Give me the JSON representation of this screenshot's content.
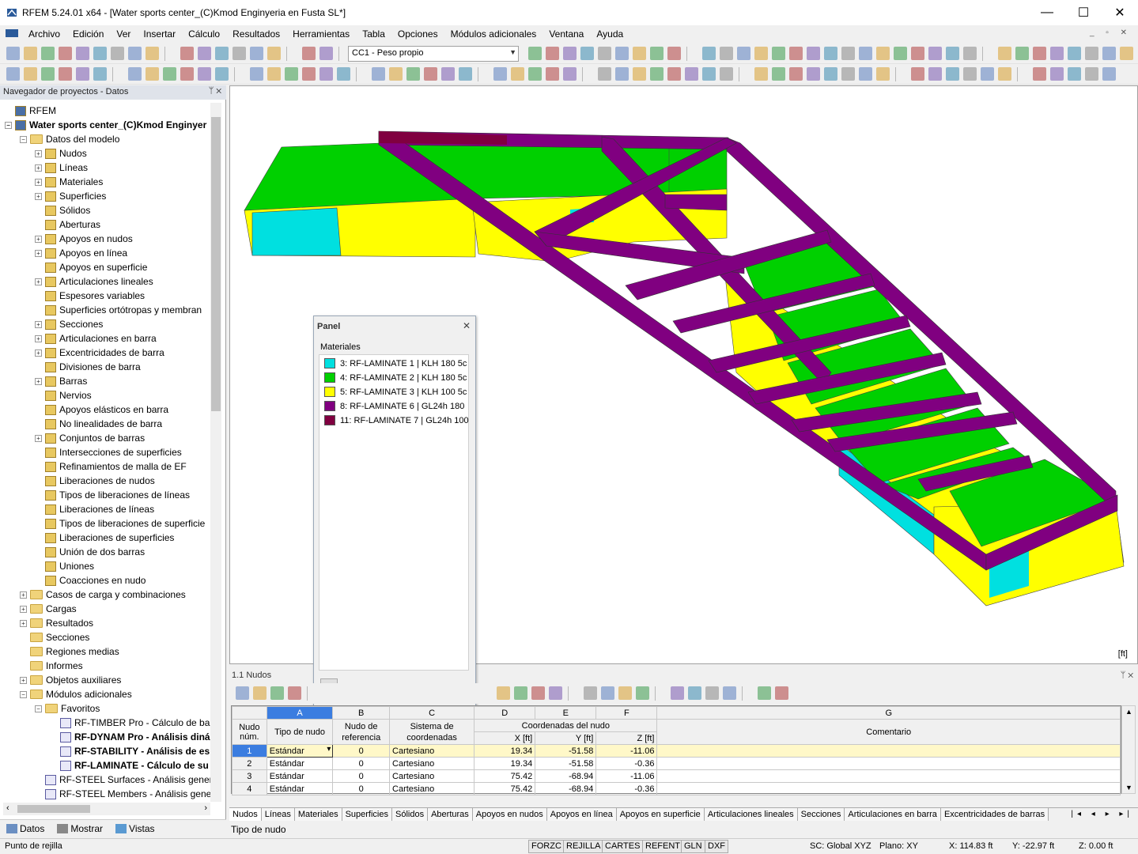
{
  "window": {
    "title": "RFEM 5.24.01 x64 - [Water sports center_(C)Kmod Enginyeria en Fusta SL*]",
    "minimize": "—",
    "maximize": "☐",
    "close": "✕"
  },
  "menu": [
    "Archivo",
    "Edición",
    "Ver",
    "Insertar",
    "Cálculo",
    "Resultados",
    "Herramientas",
    "Tabla",
    "Opciones",
    "Módulos adicionales",
    "Ventana",
    "Ayuda"
  ],
  "toolbar": {
    "load_case": "CC1 - Peso propio"
  },
  "navigator": {
    "title": "Navegador de proyectos - Datos",
    "items": [
      {
        "label": "RFEM",
        "lvl": 0,
        "ex": "",
        "icon": "rfem"
      },
      {
        "label": "Water sports center_(C)Kmod Enginyer",
        "lvl": 0,
        "ex": "−",
        "icon": "model",
        "bold": true
      },
      {
        "label": "Datos del modelo",
        "lvl": 1,
        "ex": "−",
        "icon": "folder"
      },
      {
        "label": "Nudos",
        "lvl": 2,
        "ex": "+",
        "icon": "doc"
      },
      {
        "label": "Líneas",
        "lvl": 2,
        "ex": "+",
        "icon": "doc"
      },
      {
        "label": "Materiales",
        "lvl": 2,
        "ex": "+",
        "icon": "doc"
      },
      {
        "label": "Superficies",
        "lvl": 2,
        "ex": "+",
        "icon": "doc"
      },
      {
        "label": "Sólidos",
        "lvl": 2,
        "ex": "",
        "icon": "doc"
      },
      {
        "label": "Aberturas",
        "lvl": 2,
        "ex": "",
        "icon": "doc"
      },
      {
        "label": "Apoyos en nudos",
        "lvl": 2,
        "ex": "+",
        "icon": "doc"
      },
      {
        "label": "Apoyos en línea",
        "lvl": 2,
        "ex": "+",
        "icon": "doc"
      },
      {
        "label": "Apoyos en superficie",
        "lvl": 2,
        "ex": "",
        "icon": "doc"
      },
      {
        "label": "Articulaciones lineales",
        "lvl": 2,
        "ex": "+",
        "icon": "doc"
      },
      {
        "label": "Espesores variables",
        "lvl": 2,
        "ex": "",
        "icon": "doc"
      },
      {
        "label": "Superficies ortótropas y membran",
        "lvl": 2,
        "ex": "",
        "icon": "doc"
      },
      {
        "label": "Secciones",
        "lvl": 2,
        "ex": "+",
        "icon": "doc"
      },
      {
        "label": "Articulaciones en barra",
        "lvl": 2,
        "ex": "+",
        "icon": "doc"
      },
      {
        "label": "Excentricidades de barra",
        "lvl": 2,
        "ex": "+",
        "icon": "doc"
      },
      {
        "label": "Divisiones de barra",
        "lvl": 2,
        "ex": "",
        "icon": "doc"
      },
      {
        "label": "Barras",
        "lvl": 2,
        "ex": "+",
        "icon": "doc"
      },
      {
        "label": "Nervios",
        "lvl": 2,
        "ex": "",
        "icon": "doc"
      },
      {
        "label": "Apoyos elásticos en barra",
        "lvl": 2,
        "ex": "",
        "icon": "doc"
      },
      {
        "label": "No linealidades de barra",
        "lvl": 2,
        "ex": "",
        "icon": "doc"
      },
      {
        "label": "Conjuntos de barras",
        "lvl": 2,
        "ex": "+",
        "icon": "doc"
      },
      {
        "label": "Intersecciones de superficies",
        "lvl": 2,
        "ex": "",
        "icon": "doc"
      },
      {
        "label": "Refinamientos de malla de EF",
        "lvl": 2,
        "ex": "",
        "icon": "doc"
      },
      {
        "label": "Liberaciones de nudos",
        "lvl": 2,
        "ex": "",
        "icon": "doc"
      },
      {
        "label": "Tipos de liberaciones de líneas",
        "lvl": 2,
        "ex": "",
        "icon": "doc"
      },
      {
        "label": "Liberaciones de líneas",
        "lvl": 2,
        "ex": "",
        "icon": "doc"
      },
      {
        "label": "Tipos de liberaciones de superficie",
        "lvl": 2,
        "ex": "",
        "icon": "doc"
      },
      {
        "label": "Liberaciones de superficies",
        "lvl": 2,
        "ex": "",
        "icon": "doc"
      },
      {
        "label": "Unión de dos barras",
        "lvl": 2,
        "ex": "",
        "icon": "doc"
      },
      {
        "label": "Uniones",
        "lvl": 2,
        "ex": "",
        "icon": "doc"
      },
      {
        "label": "Coacciones en nudo",
        "lvl": 2,
        "ex": "",
        "icon": "doc"
      },
      {
        "label": "Casos de carga y combinaciones",
        "lvl": 1,
        "ex": "+",
        "icon": "folder"
      },
      {
        "label": "Cargas",
        "lvl": 1,
        "ex": "+",
        "icon": "folder"
      },
      {
        "label": "Resultados",
        "lvl": 1,
        "ex": "+",
        "icon": "folder"
      },
      {
        "label": "Secciones",
        "lvl": 1,
        "ex": "",
        "icon": "folder"
      },
      {
        "label": "Regiones medias",
        "lvl": 1,
        "ex": "",
        "icon": "folder"
      },
      {
        "label": "Informes",
        "lvl": 1,
        "ex": "",
        "icon": "folder"
      },
      {
        "label": "Objetos auxiliares",
        "lvl": 1,
        "ex": "+",
        "icon": "folder"
      },
      {
        "label": "Módulos adicionales",
        "lvl": 1,
        "ex": "−",
        "icon": "folder"
      },
      {
        "label": "Favoritos",
        "lvl": 2,
        "ex": "−",
        "icon": "folder"
      },
      {
        "label": "RF-TIMBER Pro - Cálculo de ba",
        "lvl": 3,
        "ex": "",
        "icon": "mod"
      },
      {
        "label": "RF-DYNAM Pro - Análisis diná",
        "lvl": 3,
        "ex": "",
        "icon": "mod",
        "bold": true
      },
      {
        "label": "RF-STABILITY - Análisis de es",
        "lvl": 3,
        "ex": "",
        "icon": "mod",
        "bold": true
      },
      {
        "label": "RF-LAMINATE - Cálculo de su",
        "lvl": 3,
        "ex": "",
        "icon": "mod",
        "bold": true
      },
      {
        "label": "RF-STEEL Surfaces - Análisis gener",
        "lvl": 2,
        "ex": "",
        "icon": "mod"
      },
      {
        "label": "RF-STEEL Members - Análisis gene",
        "lvl": 2,
        "ex": "",
        "icon": "mod"
      }
    ],
    "tabs": [
      "Datos",
      "Mostrar",
      "Vistas"
    ]
  },
  "viewport": {
    "unit": "[ft]"
  },
  "panel": {
    "title": "Panel",
    "group": "Materiales",
    "legend": [
      {
        "label": "3: RF-LAMINATE 1 | KLH 180 5c",
        "color": "#00e0e0"
      },
      {
        "label": "4: RF-LAMINATE 2 | KLH 180 5c",
        "color": "#00d000"
      },
      {
        "label": "5: RF-LAMINATE 3 | KLH 100 5c",
        "color": "#ffff00"
      },
      {
        "label": "8: RF-LAMINATE 6 | GL24h 180",
        "color": "#800080"
      },
      {
        "label": "11: RF-LAMINATE 7 | GL24h 100",
        "color": "#800040"
      }
    ]
  },
  "table": {
    "title": "1.1 Nudos",
    "col_letters": [
      "A",
      "B",
      "C",
      "D",
      "E",
      "F",
      "G"
    ],
    "h_nudo": "Nudo",
    "h_num": "núm.",
    "h_tipo": "Tipo de nudo",
    "h_ref1": "Nudo de",
    "h_ref2": "referencia",
    "h_sis1": "Sistema de",
    "h_sis2": "coordenadas",
    "h_coord": "Coordenadas del nudo",
    "h_x": "X [ft]",
    "h_y": "Y [ft]",
    "h_z": "Z [ft]",
    "h_com": "Comentario",
    "rows": [
      {
        "n": "1",
        "tipo": "Estándar",
        "ref": "0",
        "sis": "Cartesiano",
        "x": "19.34",
        "y": "-51.58",
        "z": "-11.06"
      },
      {
        "n": "2",
        "tipo": "Estándar",
        "ref": "0",
        "sis": "Cartesiano",
        "x": "19.34",
        "y": "-51.58",
        "z": "-0.36"
      },
      {
        "n": "3",
        "tipo": "Estándar",
        "ref": "0",
        "sis": "Cartesiano",
        "x": "75.42",
        "y": "-68.94",
        "z": "-11.06"
      },
      {
        "n": "4",
        "tipo": "Estándar",
        "ref": "0",
        "sis": "Cartesiano",
        "x": "75.42",
        "y": "-68.94",
        "z": "-0.36"
      }
    ],
    "sheet_tabs": [
      "Nudos",
      "Líneas",
      "Materiales",
      "Superficies",
      "Sólidos",
      "Aberturas",
      "Apoyos en nudos",
      "Apoyos en línea",
      "Apoyos en superficie",
      "Articulaciones lineales",
      "Secciones",
      "Articulaciones en barra",
      "Excentricidades de barras"
    ],
    "hint": "Tipo de nudo"
  },
  "status": {
    "left": "Punto de rejilla",
    "toggles": [
      "FORZC",
      "REJILLA",
      "CARTES",
      "REFENT",
      "GLN",
      "DXF"
    ],
    "sc": "SC: Global XYZ",
    "plano": "Plano: XY",
    "x": "X:  114.83 ft",
    "y": "Y:  -22.97 ft",
    "z": "Z:   0.00 ft"
  }
}
